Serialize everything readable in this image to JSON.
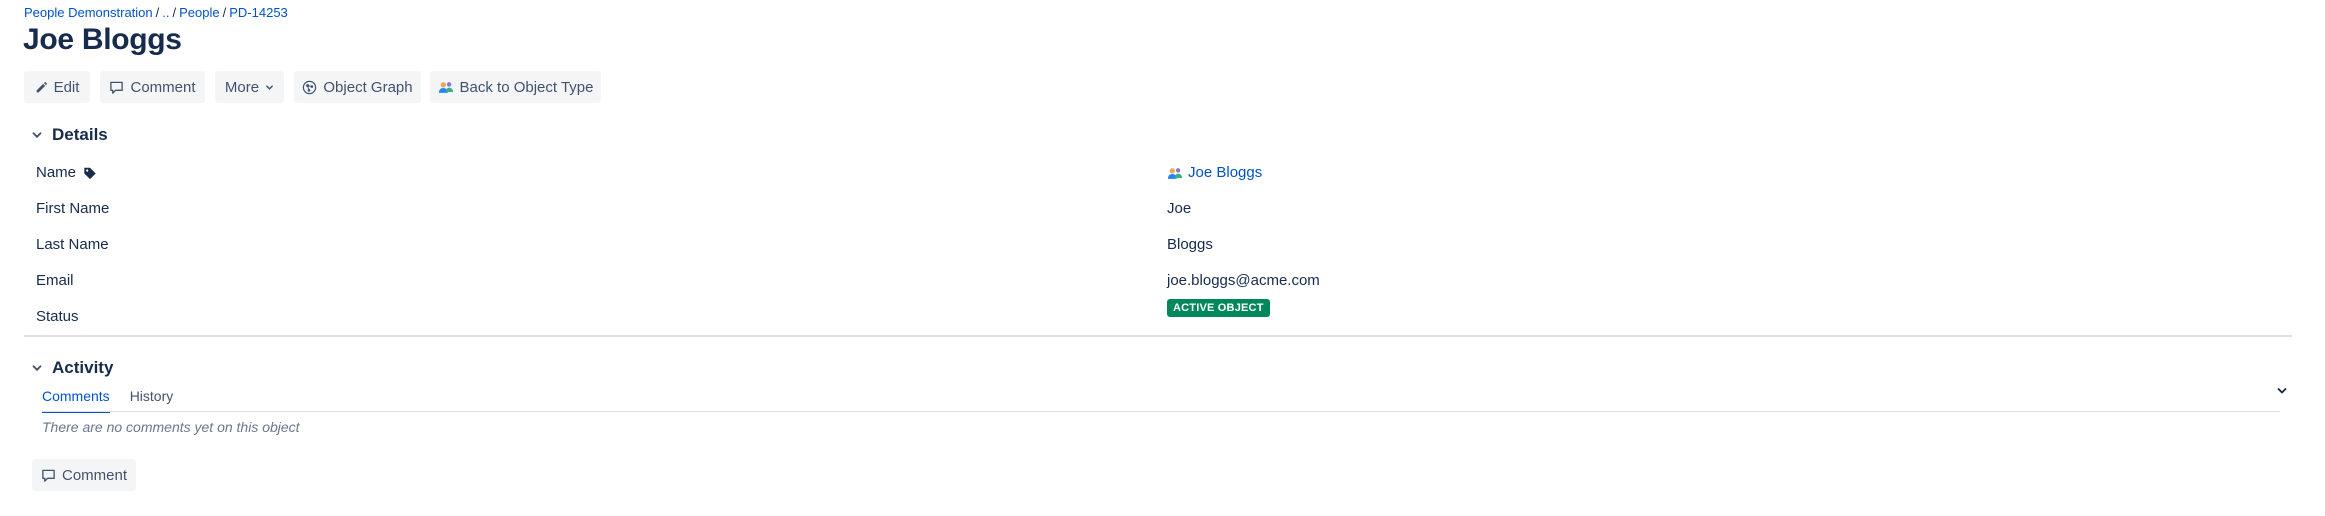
{
  "breadcrumb": {
    "items": [
      "People Demonstration",
      "..",
      "People",
      "PD-14253"
    ],
    "separator": "/"
  },
  "title": "Joe Bloggs",
  "toolbar": {
    "edit_label": "Edit",
    "comment_label": "Comment",
    "more_label": "More",
    "graph_label": "Object Graph",
    "back_label": "Back to Object Type"
  },
  "details": {
    "heading": "Details",
    "rows": [
      {
        "label": "Name",
        "value": "Joe Bloggs"
      },
      {
        "label": "First Name",
        "value": "Joe"
      },
      {
        "label": "Last Name",
        "value": "Bloggs"
      },
      {
        "label": "Email",
        "value": "joe.bloggs@acme.com"
      },
      {
        "label": "Status",
        "value": "ACTIVE OBJECT"
      }
    ]
  },
  "activity": {
    "heading": "Activity",
    "tabs": [
      "Comments",
      "History"
    ],
    "active_tab": "Comments",
    "empty_message": "There are no comments yet on this object",
    "comment_button": "Comment"
  },
  "colors": {
    "link": "#0052cc",
    "text": "#172b4d",
    "button_bg": "#f4f5f7",
    "status_active": "#00875a"
  },
  "icons": {
    "edit": "pencil-icon",
    "comment": "speech-bubble-icon",
    "more": "chevron-down-icon",
    "graph": "graph-icon",
    "back": "object-type-icon",
    "label_tag": "tag-icon",
    "avatar": "person-avatar-icon"
  }
}
